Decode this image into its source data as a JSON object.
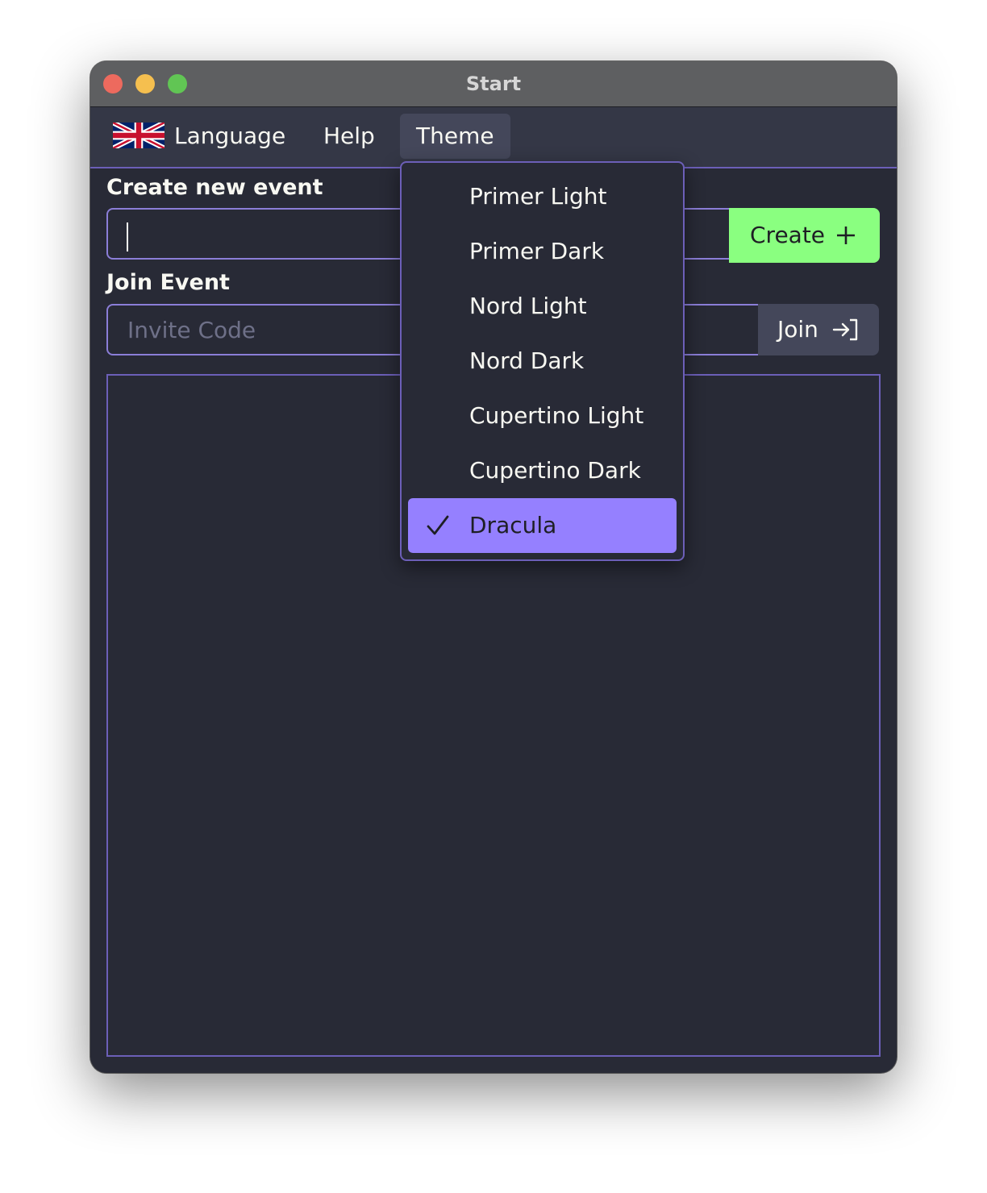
{
  "window": {
    "title": "Start"
  },
  "menubar": {
    "language": "Language",
    "help": "Help",
    "theme": "Theme"
  },
  "create": {
    "label": "Create new event",
    "input_value": "",
    "button_label": "Create"
  },
  "join": {
    "label": "Join Event",
    "placeholder": "Invite Code",
    "button_label": "Join"
  },
  "theme_menu": {
    "items": [
      {
        "label": "Primer Light",
        "selected": false
      },
      {
        "label": "Primer Dark",
        "selected": false
      },
      {
        "label": "Nord Light",
        "selected": false
      },
      {
        "label": "Nord Dark",
        "selected": false
      },
      {
        "label": "Cupertino Light",
        "selected": false
      },
      {
        "label": "Cupertino Dark",
        "selected": false
      },
      {
        "label": "Dracula",
        "selected": true
      }
    ]
  },
  "icons": {
    "language": "uk-flag-icon",
    "create": "plus-icon",
    "join": "sign-in-icon",
    "selected": "check-icon"
  },
  "colors": {
    "background": "#282a36",
    "menubar": "#343746",
    "accent_border": "#8b7ed8",
    "create_button": "#8aff80",
    "selected_item": "#9580ff",
    "join_button": "#44475a"
  }
}
